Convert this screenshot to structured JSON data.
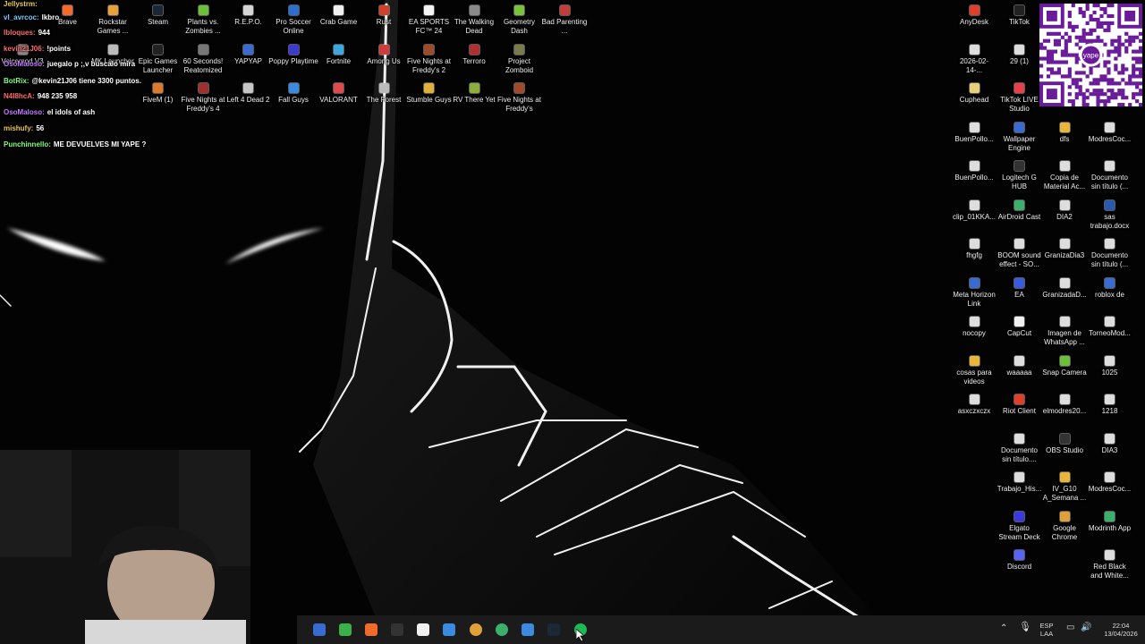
{
  "desktop": {
    "left_icons": [
      {
        "label": "Brave",
        "color": "#f46a2a",
        "col": 1,
        "row": 0
      },
      {
        "label": "Rockstar Games ...",
        "color": "#e9a23b",
        "col": 2,
        "row": 0
      },
      {
        "label": "Steam",
        "color": "#1b2838",
        "col": 3,
        "row": 0
      },
      {
        "label": "Plants vs. Zombies ...",
        "color": "#6bbf3b",
        "col": 4,
        "row": 0
      },
      {
        "label": "R.E.P.O.",
        "color": "#d6d6d6",
        "col": 5,
        "row": 0
      },
      {
        "label": "Pro Soccer Online",
        "color": "#2d6fd1",
        "col": 6,
        "row": 0
      },
      {
        "label": "Crab Game",
        "color": "#f0f0f0",
        "col": 7,
        "row": 0
      },
      {
        "label": "Rust",
        "color": "#ce422b",
        "col": 8,
        "row": 0
      },
      {
        "label": "EA SPORTS FC™ 24",
        "color": "#f4f4f4",
        "col": 9,
        "row": 0
      },
      {
        "label": "The Walking Dead",
        "color": "#8a8a8a",
        "col": 10,
        "row": 0
      },
      {
        "label": "Geometry Dash",
        "color": "#79c23a",
        "col": 11,
        "row": 0
      },
      {
        "label": "Bad Parenting ...",
        "color": "#c63b3b",
        "col": 12,
        "row": 0
      },
      {
        "label": "Voicemod V3",
        "color": "#8a8a8a",
        "col": 0,
        "row": 1
      },
      {
        "label": "MK Launcher",
        "color": "#bbbbbb",
        "col": 2,
        "row": 1
      },
      {
        "label": "Epic Games Launcher",
        "color": "#222222",
        "col": 3,
        "row": 1
      },
      {
        "label": "60 Seconds! Reatomized",
        "color": "#777777",
        "col": 4,
        "row": 1
      },
      {
        "label": "YAPYAP",
        "color": "#3a6bd1",
        "col": 5,
        "row": 1
      },
      {
        "label": "Poppy Playtime",
        "color": "#3b3bd1",
        "col": 6,
        "row": 1
      },
      {
        "label": "Fortnite",
        "color": "#3aa9e0",
        "col": 7,
        "row": 1
      },
      {
        "label": "Among Us",
        "color": "#d13b3b",
        "col": 8,
        "row": 1
      },
      {
        "label": "Five Nights at Freddy's 2",
        "color": "#a04a2a",
        "col": 9,
        "row": 1
      },
      {
        "label": "Terroro",
        "color": "#b03030",
        "col": 10,
        "row": 1
      },
      {
        "label": "Project Zomboid",
        "color": "#7a7a4a",
        "col": 11,
        "row": 1
      },
      {
        "label": "FiveM (1)",
        "color": "#e07a2a",
        "col": 3,
        "row": 2
      },
      {
        "label": "Five Nights at Freddy's 4",
        "color": "#a03030",
        "col": 4,
        "row": 2
      },
      {
        "label": "Left 4 Dead 2",
        "color": "#c6c6c6",
        "col": 5,
        "row": 2
      },
      {
        "label": "Fall Guys",
        "color": "#3a8ae0",
        "col": 6,
        "row": 2
      },
      {
        "label": "VALORANT",
        "color": "#e04a4a",
        "col": 7,
        "row": 2
      },
      {
        "label": "The Forest",
        "color": "#bbbbbb",
        "col": 8,
        "row": 2
      },
      {
        "label": "Stumble Guys",
        "color": "#e0b03a",
        "col": 9,
        "row": 2
      },
      {
        "label": "RV There Yet",
        "color": "#8ab03a",
        "col": 10,
        "row": 2
      },
      {
        "label": "Five Nights at Freddy's",
        "color": "#a04a2a",
        "col": 11,
        "row": 2
      }
    ],
    "right_icons": [
      {
        "label": "AnyDesk",
        "color": "#e0402a",
        "col": 0,
        "row": 0
      },
      {
        "label": "TikTok",
        "color": "#222222",
        "col": 1,
        "row": 0
      },
      {
        "label": "2026-02-14-...",
        "color": "#dddddd",
        "col": 0,
        "row": 1
      },
      {
        "label": "29 (1)",
        "color": "#dddddd",
        "col": 1,
        "row": 1
      },
      {
        "label": "Cuphead",
        "color": "#e8d07a",
        "col": 0,
        "row": 2
      },
      {
        "label": "TikTok LIVE Studio",
        "color": "#e8404a",
        "col": 1,
        "row": 2
      },
      {
        "label": "BuenPollo...",
        "color": "#dddddd",
        "col": 0,
        "row": 3
      },
      {
        "label": "Wallpaper Engine",
        "color": "#3a6bd1",
        "col": 1,
        "row": 3
      },
      {
        "label": "dfs",
        "color": "#e8b63a",
        "col": 2,
        "row": 3
      },
      {
        "label": "ModresCoc...",
        "color": "#dddddd",
        "col": 3,
        "row": 3
      },
      {
        "label": "BuenPollo...",
        "color": "#dddddd",
        "col": 0,
        "row": 4
      },
      {
        "label": "Logitech G HUB",
        "color": "#333333",
        "col": 1,
        "row": 4
      },
      {
        "label": "Copia de Material Ac...",
        "color": "#dddddd",
        "col": 2,
        "row": 4
      },
      {
        "label": "Documento sin título (...",
        "color": "#dddddd",
        "col": 3,
        "row": 4
      },
      {
        "label": "clip_01KKA...",
        "color": "#dddddd",
        "col": 0,
        "row": 5
      },
      {
        "label": "AirDroid Cast",
        "color": "#3ab06b",
        "col": 1,
        "row": 5
      },
      {
        "label": "DIA2",
        "color": "#dddddd",
        "col": 2,
        "row": 5
      },
      {
        "label": "sas trabajo.docx",
        "color": "#2a5ab0",
        "col": 3,
        "row": 5
      },
      {
        "label": "fhgfg",
        "color": "#dddddd",
        "col": 0,
        "row": 6
      },
      {
        "label": "BOOM sound effect - SO...",
        "color": "#dddddd",
        "col": 1,
        "row": 6
      },
      {
        "label": "GranizaDia3",
        "color": "#dddddd",
        "col": 2,
        "row": 6
      },
      {
        "label": "Documento sin título (...",
        "color": "#dddddd",
        "col": 3,
        "row": 6
      },
      {
        "label": "Meta Horizon Link",
        "color": "#3a6bd1",
        "col": 0,
        "row": 7
      },
      {
        "label": "EA",
        "color": "#3a5ae0",
        "col": 1,
        "row": 7
      },
      {
        "label": "GranizadaD...",
        "color": "#dddddd",
        "col": 2,
        "row": 7
      },
      {
        "label": "roblox de",
        "color": "#3a6bd1",
        "col": 3,
        "row": 7
      },
      {
        "label": "nocopy",
        "color": "#dddddd",
        "col": 0,
        "row": 8
      },
      {
        "label": "CapCut",
        "color": "#f0f0f0",
        "col": 1,
        "row": 8
      },
      {
        "label": "Imagen de WhatsApp ...",
        "color": "#dddddd",
        "col": 2,
        "row": 8
      },
      {
        "label": "TorneoMod...",
        "color": "#dddddd",
        "col": 3,
        "row": 8
      },
      {
        "label": "cosas para videos",
        "color": "#e8b63a",
        "col": 0,
        "row": 9
      },
      {
        "label": "waaaaa",
        "color": "#dddddd",
        "col": 1,
        "row": 9
      },
      {
        "label": "Snap Camera",
        "color": "#6bbf3b",
        "col": 2,
        "row": 9
      },
      {
        "label": "1025",
        "color": "#dddddd",
        "col": 3,
        "row": 9
      },
      {
        "label": "asxczxczx",
        "color": "#dddddd",
        "col": 0,
        "row": 10
      },
      {
        "label": "Riot Client",
        "color": "#e0402a",
        "col": 1,
        "row": 10
      },
      {
        "label": "elmodres20...",
        "color": "#dddddd",
        "col": 2,
        "row": 10
      },
      {
        "label": "1218",
        "color": "#dddddd",
        "col": 3,
        "row": 10
      },
      {
        "label": "Documento sin título....",
        "color": "#dddddd",
        "col": 1,
        "row": 11
      },
      {
        "label": "OBS Studio",
        "color": "#333333",
        "col": 2,
        "row": 11
      },
      {
        "label": "DIA3",
        "color": "#dddddd",
        "col": 3,
        "row": 11
      },
      {
        "label": "Trabajo_His...",
        "color": "#dddddd",
        "col": 1,
        "row": 12
      },
      {
        "label": "IV_G10 A_Semana ...",
        "color": "#e8b63a",
        "col": 2,
        "row": 12
      },
      {
        "label": "ModresCoc...",
        "color": "#dddddd",
        "col": 3,
        "row": 12
      },
      {
        "label": "Elgato Stream Deck",
        "color": "#3a3ae0",
        "col": 1,
        "row": 13
      },
      {
        "label": "Google Chrome",
        "color": "#e0a03a",
        "col": 2,
        "row": 13
      },
      {
        "label": "Modrinth App",
        "color": "#3ab06b",
        "col": 3,
        "row": 13
      },
      {
        "label": "Discord",
        "color": "#5865f2",
        "col": 1,
        "row": 14
      },
      {
        "label": "Red Black and White...",
        "color": "#dddddd",
        "col": 3,
        "row": 14
      }
    ]
  },
  "chat": [
    {
      "user": "Jellystrm:",
      "text": "",
      "color": "#e8c84a"
    },
    {
      "user": "vl_avrcoc:",
      "text": "lkbro",
      "color": "#7ac8ff"
    },
    {
      "user": "Ibloques:",
      "text": "944",
      "color": "#ff6b6b"
    },
    {
      "user": "kevin21J06:",
      "text": "!points",
      "color": "#ff6b6b"
    },
    {
      "user": "OsoMaloso:",
      "text": "juegalo p ;,v buscalo mira",
      "color": "#c27bff"
    },
    {
      "user": "BotRix:",
      "text": "@kevin21J06 tiene 3300 puntos.",
      "color": "#7dff7a"
    },
    {
      "user": "N4I8hcA:",
      "text": "948 235 958",
      "color": "#ff6b6b"
    },
    {
      "user": "OsoMaloso:",
      "text": "el idols of ash",
      "color": "#c27bff"
    },
    {
      "user": "mishufy:",
      "text": "56",
      "color": "#e8c84a"
    },
    {
      "user": "Punchinnello:",
      "text": "ME DEVUELVES MI YAPE ?",
      "color": "#7dff7a"
    }
  ],
  "qr": {
    "brand": "yape",
    "accent": "#6a1b9a"
  },
  "taskbar": {
    "apps": [
      {
        "name": "start-icon",
        "color": "#3a6bd1"
      },
      {
        "name": "xbox-icon",
        "color": "#3ab04a"
      },
      {
        "name": "brave-icon",
        "color": "#f46a2a"
      },
      {
        "name": "epic-games-icon",
        "color": "#333333"
      },
      {
        "name": "capcut-icon",
        "color": "#f0f0f0"
      },
      {
        "name": "calculator-icon",
        "color": "#3a8ae0"
      },
      {
        "name": "chrome-icon",
        "color": "#e0a03a"
      },
      {
        "name": "whatsapp-icon",
        "color": "#3ab06b"
      },
      {
        "name": "notepad-icon",
        "color": "#3a8ae0"
      },
      {
        "name": "steam-icon",
        "color": "#1b2838"
      },
      {
        "name": "spotify-icon",
        "color": "#1db954"
      }
    ],
    "lang": "ESP",
    "lang_sub": "LAA",
    "time": "22:04",
    "date": "13/04/2026"
  }
}
